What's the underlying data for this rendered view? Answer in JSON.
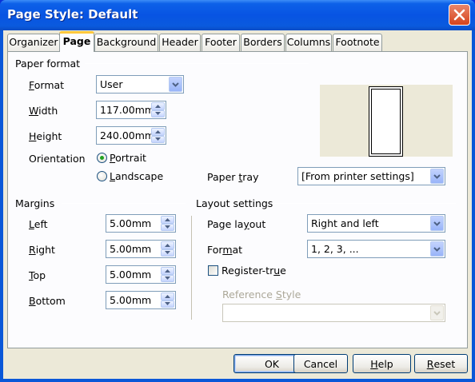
{
  "window": {
    "title": "Page Style: Default"
  },
  "tabs": [
    {
      "label": "Organizer",
      "active": false
    },
    {
      "label": "Page",
      "active": true
    },
    {
      "label": "Background",
      "active": false
    },
    {
      "label": "Header",
      "active": false
    },
    {
      "label": "Footer",
      "active": false
    },
    {
      "label": "Borders",
      "active": false
    },
    {
      "label": "Columns",
      "active": false
    },
    {
      "label": "Footnote",
      "active": false
    }
  ],
  "paper_format": {
    "heading": "Paper format",
    "format_label_pre": "",
    "format_label_ul": "F",
    "format_label_post": "ormat",
    "format_value": "User",
    "width_label_pre": "",
    "width_label_ul": "W",
    "width_label_post": "idth",
    "width_value": "117.00mm",
    "height_label_pre": "",
    "height_label_ul": "H",
    "height_label_post": "eight",
    "height_value": "240.00mm",
    "orientation_label": "Orientation",
    "portrait_pre": "",
    "portrait_ul": "P",
    "portrait_post": "ortrait",
    "landscape_pre": "",
    "landscape_ul": "L",
    "landscape_post": "andscape",
    "orientation_selected": "Portrait",
    "tray_label_pre": "Paper ",
    "tray_label_ul": "t",
    "tray_label_post": "ray",
    "tray_value": "[From printer settings]"
  },
  "margins": {
    "heading": "Margins",
    "left_pre": "",
    "left_ul": "L",
    "left_post": "eft",
    "left_value": "5.00mm",
    "right_pre": "",
    "right_ul": "R",
    "right_post": "ight",
    "right_value": "5.00mm",
    "top_pre": "",
    "top_ul": "T",
    "top_post": "op",
    "top_value": "5.00mm",
    "bottom_pre": "",
    "bottom_ul": "B",
    "bottom_post": "ottom",
    "bottom_value": "5.00mm"
  },
  "layout": {
    "heading": "Layout settings",
    "page_layout_pre": "Page la",
    "page_layout_ul": "y",
    "page_layout_post": "out",
    "page_layout_value": "Right and left",
    "format_pre": "For",
    "format_ul": "m",
    "format_post": "at",
    "format_value": "1, 2, 3, ...",
    "register_pre": "Register-tr",
    "register_ul": "u",
    "register_post": "e",
    "register_checked": false,
    "reference_pre": "Reference ",
    "reference_ul": "S",
    "reference_post": "tyle",
    "reference_value": ""
  },
  "buttons": {
    "ok": "OK",
    "cancel": "Cancel",
    "help_pre": "",
    "help_ul": "H",
    "help_post": "elp",
    "reset_pre": "",
    "reset_ul": "R",
    "reset_post": "eset"
  },
  "colors": {
    "titlebar": "#0854e3",
    "dialog_bg": "#ece9d8",
    "active_tab_accent": "#ffc83c",
    "close_button": "#d6431c"
  },
  "icons": {
    "close": "close-x-icon",
    "spin": "spin-up-down-arrows",
    "dropdown": "chevron-down-icon"
  }
}
